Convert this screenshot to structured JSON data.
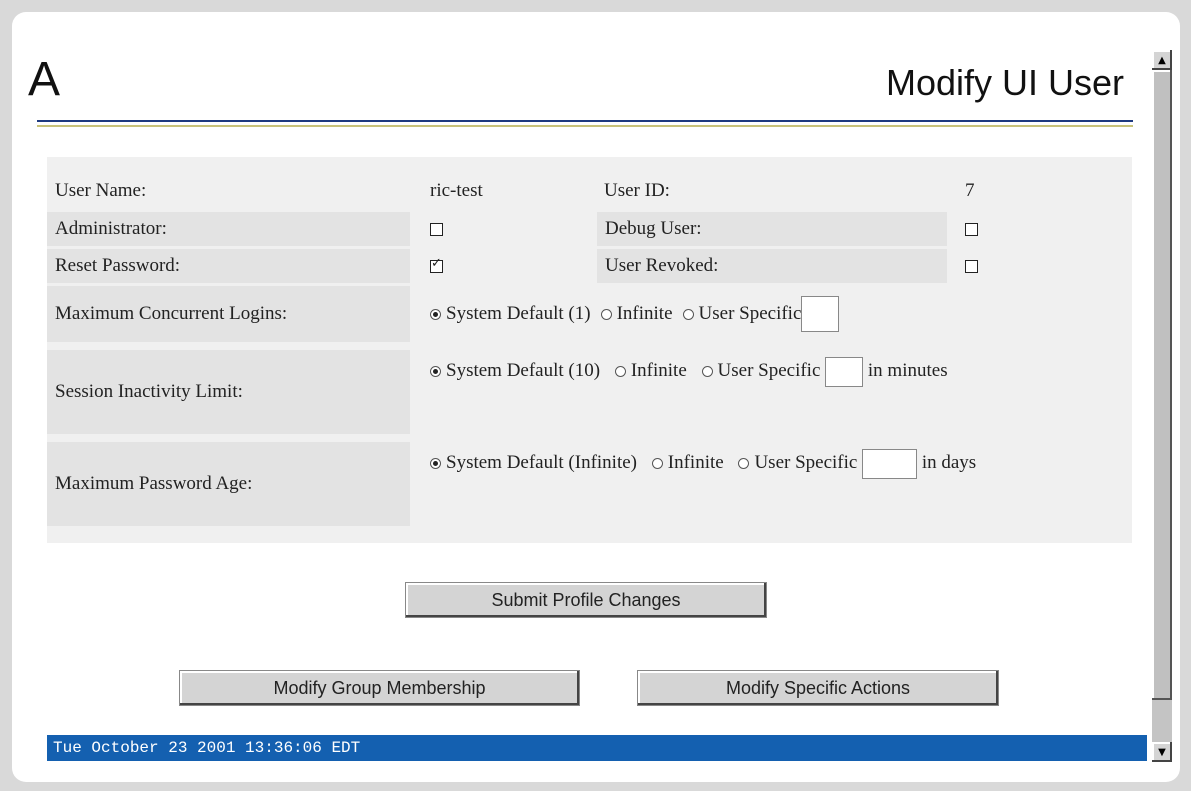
{
  "logo_letter": "A",
  "page_title": "Modify UI User",
  "form": {
    "user_name_label": "User Name:",
    "user_name_value": "ric-test",
    "user_id_label": "User ID:",
    "user_id_value": "7",
    "administrator_label": "Administrator:",
    "administrator_checked": false,
    "debug_user_label": "Debug User:",
    "debug_user_checked": false,
    "reset_password_label": "Reset Password:",
    "reset_password_checked": true,
    "user_revoked_label": "User Revoked:",
    "user_revoked_checked": false,
    "max_logins": {
      "label": "Maximum Concurrent Logins:",
      "options": [
        "System Default (1)",
        "Infinite",
        "User Specific"
      ],
      "selected": "System Default (1)",
      "value": "",
      "unit": ""
    },
    "session_limit": {
      "label": "Session Inactivity Limit:",
      "options": [
        "System Default (10)",
        "Infinite",
        "User Specific"
      ],
      "selected": "System Default (10)",
      "value": "",
      "unit": "in minutes"
    },
    "password_age": {
      "label": "Maximum Password Age:",
      "options": [
        "System Default (Infinite)",
        "Infinite",
        "User Specific"
      ],
      "selected": "System Default (Infinite)",
      "value": "",
      "unit": "in days"
    }
  },
  "buttons": {
    "submit": "Submit Profile Changes",
    "group_membership": "Modify Group Membership",
    "specific_actions": "Modify Specific Actions"
  },
  "status_bar": "Tue October 23 2001 13:36:06 EDT",
  "icons": {
    "scroll_up": "triangle-up",
    "scroll_down": "triangle-down"
  },
  "colors": {
    "status_bar": "#1460b0",
    "rule_blue": "#1e3a80",
    "rule_gold": "#c8c27a"
  }
}
